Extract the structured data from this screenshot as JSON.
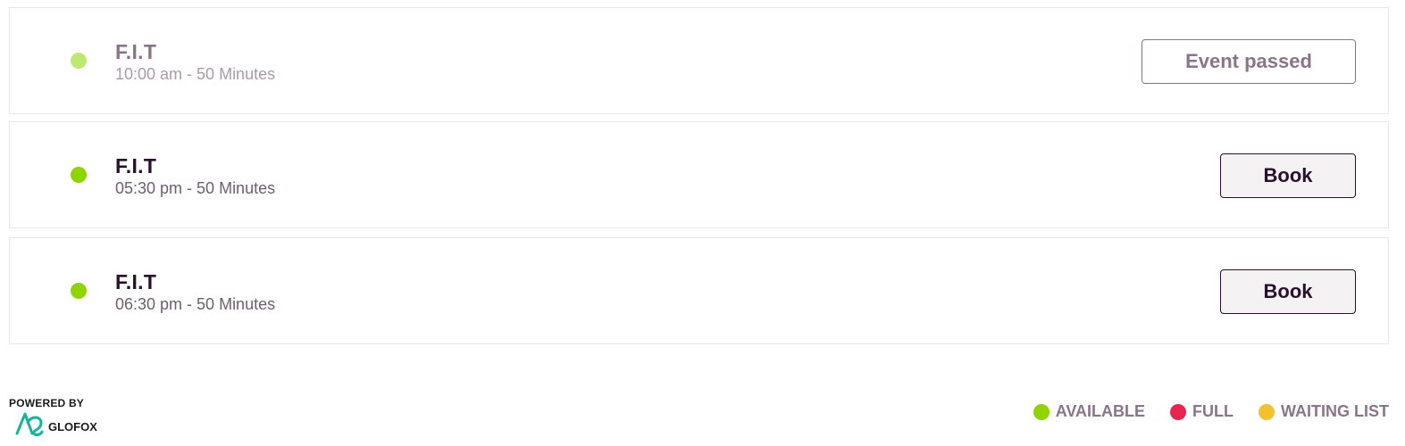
{
  "events": [
    {
      "name": "F.I.T",
      "time": "10:00 am - 50 Minutes",
      "action_label": "Event passed",
      "status": "available",
      "passed": true
    },
    {
      "name": "F.I.T",
      "time": "05:30 pm - 50 Minutes",
      "action_label": "Book",
      "status": "available",
      "passed": false
    },
    {
      "name": "F.I.T",
      "time": "06:30 pm - 50 Minutes",
      "action_label": "Book",
      "status": "available",
      "passed": false
    }
  ],
  "footer": {
    "powered_by": "POWERED BY",
    "logo_text": "GLOFOX",
    "logo_color": "#17b39a"
  },
  "legend": [
    {
      "label": "AVAILABLE",
      "color": "#8fd400"
    },
    {
      "label": "FULL",
      "color": "#e8254f"
    },
    {
      "label": "WAITING LIST",
      "color": "#f2c12e"
    }
  ],
  "colors": {
    "available": "#8fd400",
    "available_passed": "#bfe870",
    "text_primary": "#2a0f2e",
    "text_muted": "#8a7489"
  }
}
